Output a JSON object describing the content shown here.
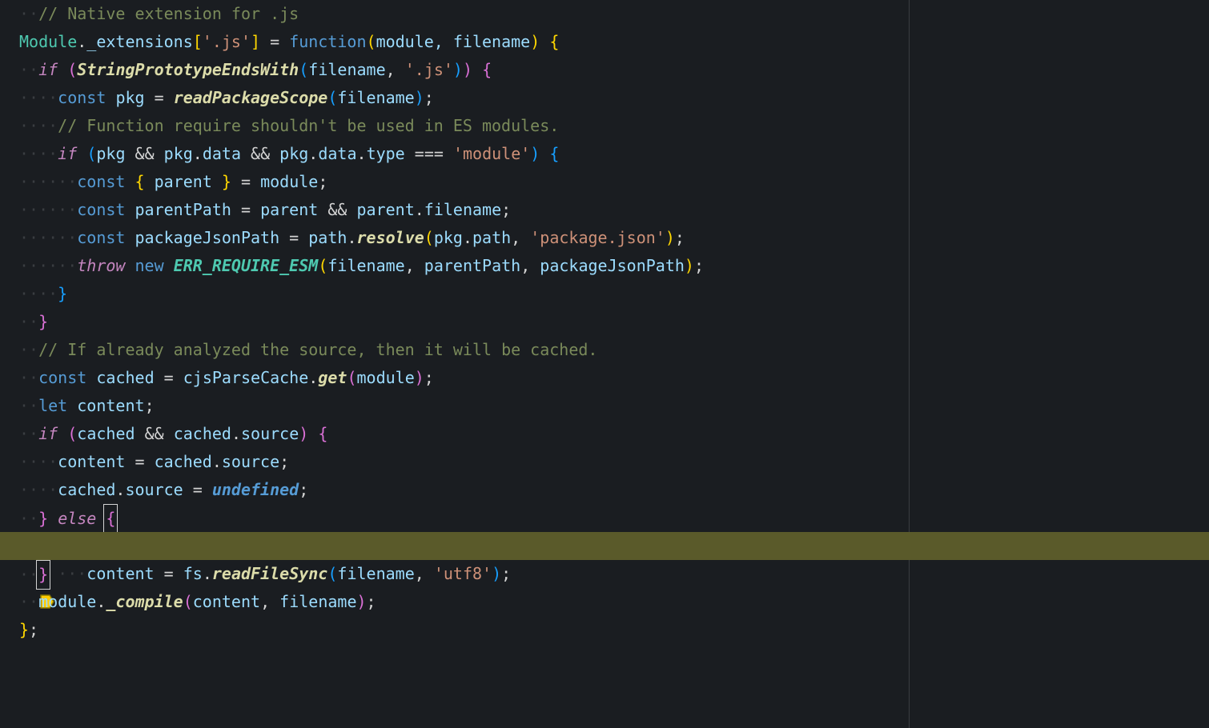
{
  "code": {
    "l1": "// Native extension for .js",
    "l2_module": "Module",
    "l2_ext": "_extensions",
    "l2_js": "'.js'",
    "l2_func": "function",
    "l2_params": "module, filename",
    "l3_if": "if",
    "l3_fn": "StringPrototypeEndsWith",
    "l3_arg1": "filename",
    "l3_arg2": "'.js'",
    "l4_const": "const",
    "l4_pkg": "pkg",
    "l4_fn": "readPackageScope",
    "l4_arg": "filename",
    "l5": "// Function require shouldn't be used in ES modules.",
    "l6_if": "if",
    "l6_pkg": "pkg",
    "l6_data": "data",
    "l6_type": "type",
    "l6_module": "'module'",
    "l7_const": "const",
    "l7_parent": "parent",
    "l7_module": "module",
    "l8_const": "const",
    "l8_pp": "parentPath",
    "l8_parent": "parent",
    "l8_filename": "filename",
    "l9_const": "const",
    "l9_var": "packageJsonPath",
    "l9_path": "path",
    "l9_resolve": "resolve",
    "l9_pkg": "pkg",
    "l9_pathprop": "path",
    "l9_str": "'package.json'",
    "l10_throw": "throw",
    "l10_new": "new",
    "l10_err": "ERR_REQUIRE_ESM",
    "l10_a1": "filename",
    "l10_a2": "parentPath",
    "l10_a3": "packageJsonPath",
    "l13": "// If already analyzed the source, then it will be cached.",
    "l14_const": "const",
    "l14_cached": "cached",
    "l14_cjs": "cjsParseCache",
    "l14_get": "get",
    "l14_module": "module",
    "l15_let": "let",
    "l15_content": "content",
    "l16_if": "if",
    "l16_cached": "cached",
    "l16_source": "source",
    "l17_content": "content",
    "l17_cached": "cached",
    "l17_source": "source",
    "l18_cached": "cached",
    "l18_source": "source",
    "l18_undef": "undefined",
    "l19_else": "else",
    "l20_content": "content",
    "l20_fs": "fs",
    "l20_fn": "readFileSync",
    "l20_a1": "filename",
    "l20_a2": "'utf8'",
    "l22_module": "module",
    "l22_compile": "_compile",
    "l22_a1": "content",
    "l22_a2": "filename"
  }
}
